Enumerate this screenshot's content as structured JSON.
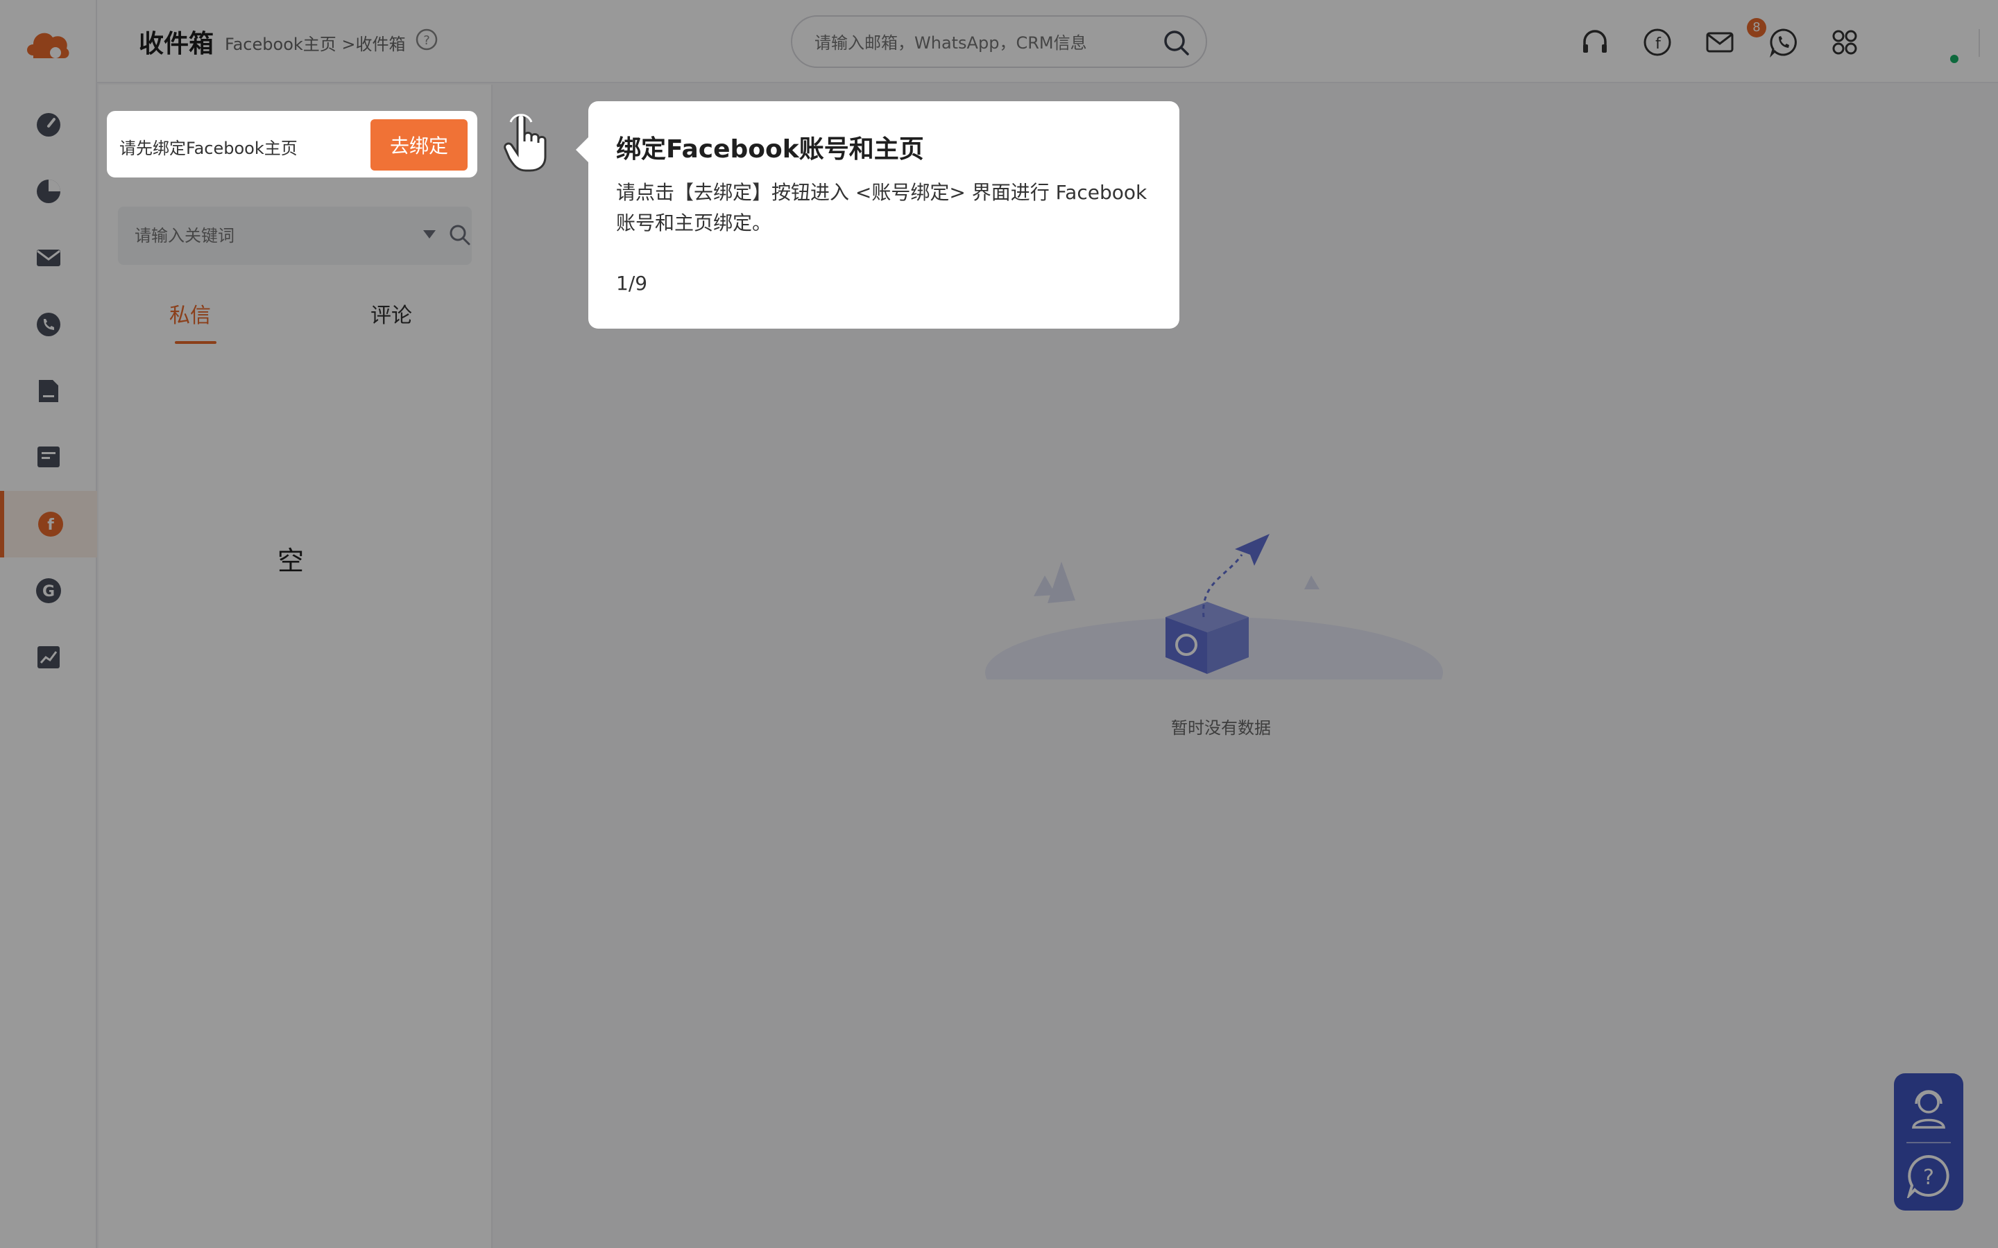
{
  "header": {
    "title": "收件箱",
    "breadcrumb": "Facebook主页 >收件箱",
    "search_placeholder": "请输入邮箱，WhatsApp，CRM信息",
    "notification_count": "8",
    "icons": [
      "headset-icon",
      "facebook-icon",
      "mail-icon",
      "whatsapp-icon",
      "apps-icon"
    ]
  },
  "sidebar": {
    "items": [
      {
        "name": "dashboard-icon"
      },
      {
        "name": "pie-chart-icon"
      },
      {
        "name": "mail-icon"
      },
      {
        "name": "phone-icon"
      },
      {
        "name": "folder-icon"
      },
      {
        "name": "message-icon"
      },
      {
        "name": "facebook-icon",
        "active": true
      },
      {
        "name": "google-icon"
      },
      {
        "name": "analytics-icon"
      }
    ]
  },
  "panel": {
    "bind_prompt": "请先绑定Facebook主页",
    "bind_button": "去绑定",
    "keyword_placeholder": "请输入关键词",
    "tabs": [
      {
        "label": "私信",
        "active": true
      },
      {
        "label": "评论",
        "active": false
      }
    ],
    "empty_label": "空"
  },
  "main": {
    "empty_text": "暂时没有数据"
  },
  "guide": {
    "title": "绑定Facebook账号和主页",
    "body": "请点击【去绑定】按钮进入 <账号绑定> 界面进行 Facebook 账号和主页绑定。",
    "step": "1/9"
  },
  "colors": {
    "accent": "#e8692c",
    "button": "#f07236",
    "rail_icon": "#4a4f5c",
    "widget": "#3e54bf"
  }
}
